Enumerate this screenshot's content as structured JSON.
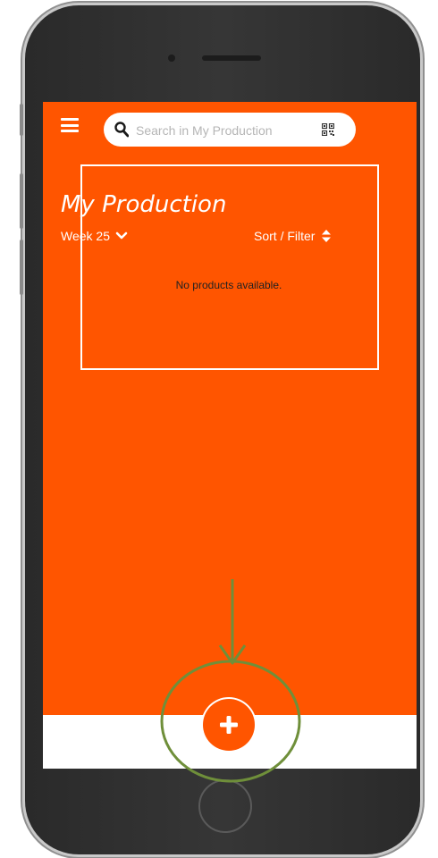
{
  "search": {
    "placeholder": "Search in My Production"
  },
  "page": {
    "title": "My Production",
    "week_label": "Week 25",
    "sort_filter_label": "Sort / Filter",
    "empty_message": "No products available."
  },
  "icons": {
    "menu": "hamburger-icon",
    "search": "search-icon",
    "qr": "qr-code-icon",
    "week_toggle": "chevron-down-icon",
    "sort": "sort-icon",
    "add": "plus-icon"
  },
  "colors": {
    "brand_orange": "#ff5500",
    "annotation_green": "#6f8f3a",
    "device_body": "#2f2f2f"
  }
}
